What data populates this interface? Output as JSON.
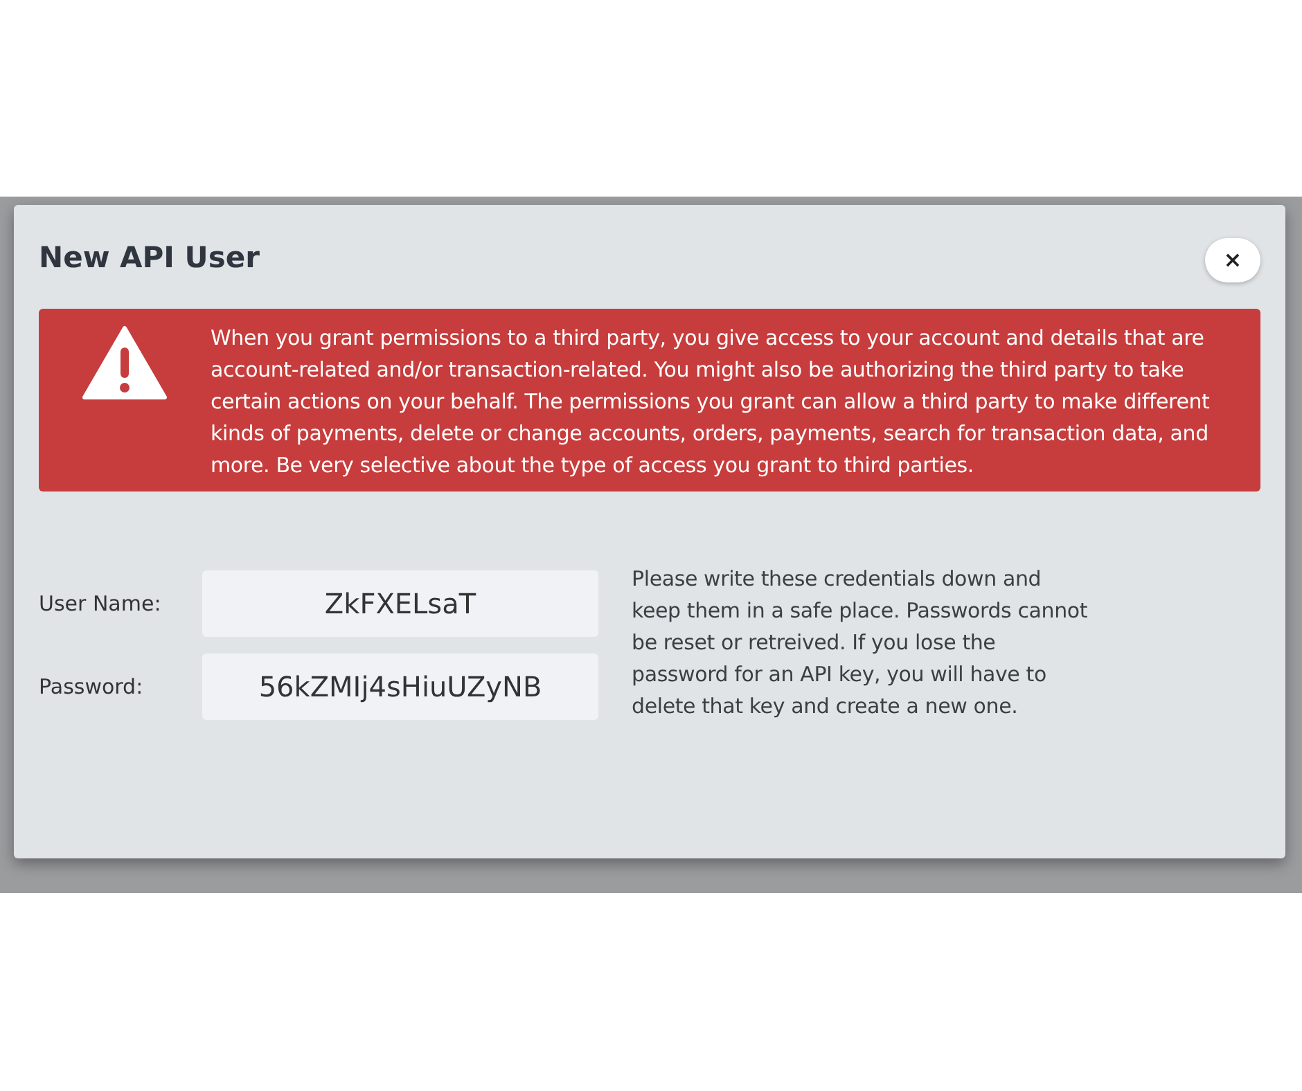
{
  "dialog": {
    "title": "New API User",
    "close": "×"
  },
  "alert": {
    "text": "When you grant permissions to a third party, you give access to your account and details that are account-related and/or transaction-related. You might also be authorizing the third party to take certain actions on your behalf. The permissions you grant can allow a third party to make different kinds of payments, delete or change accounts, orders, payments, search for transaction data, and more. Be very selective about the type of access you grant to third parties."
  },
  "fields": [
    {
      "label": "User Name:",
      "value": "ZkFXELsaT"
    },
    {
      "label": "Password:",
      "value": "56kZMIj4sHiuUZyNB"
    }
  ],
  "note": "Please write these credentials down and keep them in a safe place. Passwords cannot be reset or retreived. If you lose the password for an API key, you will have to delete that key and create a new one."
}
